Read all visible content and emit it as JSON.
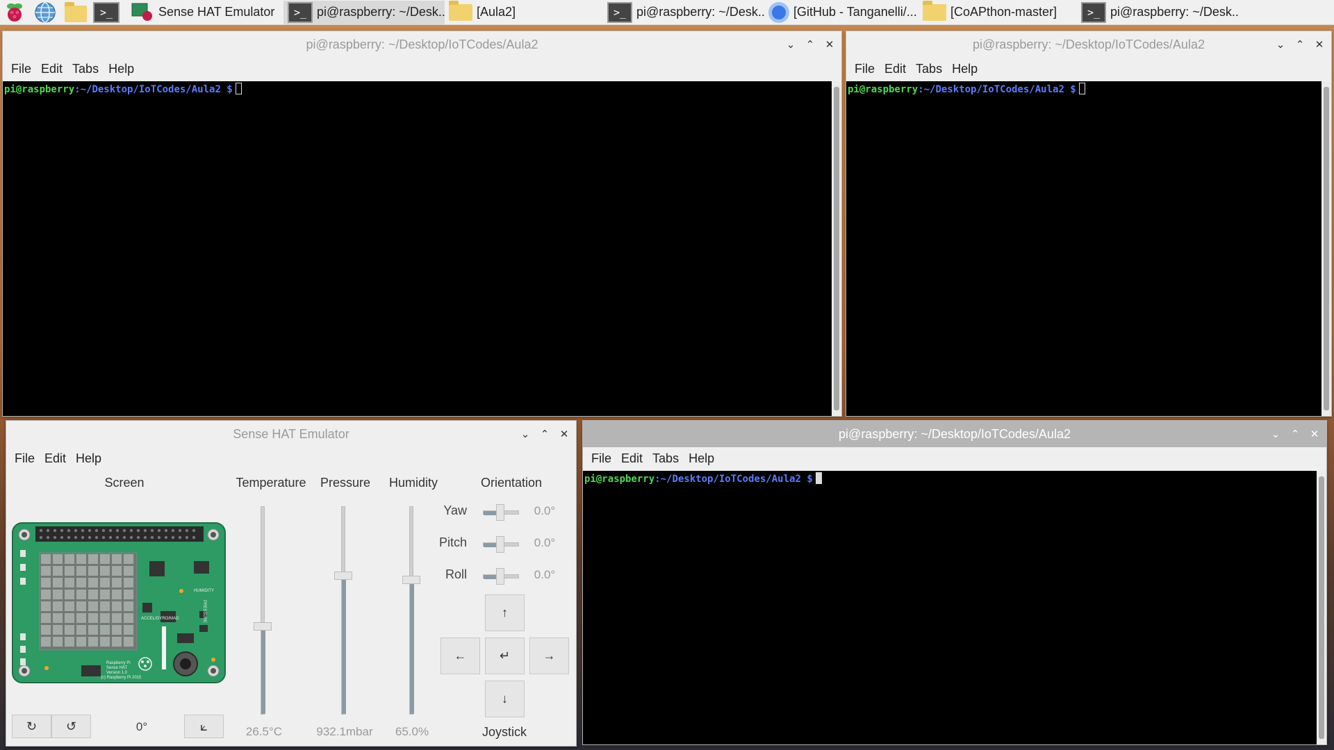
{
  "taskbar": {
    "tasks": [
      {
        "label": "Sense HAT Emulator",
        "icon": "sense-hat-icon"
      },
      {
        "label": "pi@raspberry: ~/Desk...",
        "icon": "terminal-icon"
      },
      {
        "label": "[Aula2]",
        "icon": "folder-icon"
      },
      {
        "label": "pi@raspberry: ~/Desk...",
        "icon": "terminal-icon"
      },
      {
        "label": "[GitHub - Tanganelli/...",
        "icon": "chromium-icon"
      },
      {
        "label": "[CoAPthon-master]",
        "icon": "folder-icon"
      },
      {
        "label": "pi@raspberry: ~/Desk...",
        "icon": "terminal-icon"
      }
    ],
    "terminal_glyph": ">_"
  },
  "terminals": {
    "title": "pi@raspberry: ~/Desktop/IoTCodes/Aula2",
    "menu": {
      "file": "File",
      "edit": "Edit",
      "tabs": "Tabs",
      "help": "Help"
    },
    "prompt": {
      "user": "pi@raspberry",
      "path": ":~/Desktop/IoTCodes/Aula2",
      "dollar": " $"
    }
  },
  "window_controls": {
    "minimize": "⌄",
    "maximize": "⌃",
    "close": "✕"
  },
  "sense_hat": {
    "title": "Sense HAT Emulator",
    "menu": {
      "file": "File",
      "edit": "Edit",
      "help": "Help"
    },
    "headers": {
      "screen": "Screen",
      "temperature": "Temperature",
      "pressure": "Pressure",
      "humidity": "Humidity",
      "orientation": "Orientation"
    },
    "values": {
      "temperature": "26.5°C",
      "pressure": "932.1mbar",
      "humidity": "65.0%"
    },
    "orientation": [
      {
        "label": "Yaw",
        "value": "0.0°"
      },
      {
        "label": "Pitch",
        "value": "0.0°"
      },
      {
        "label": "Roll",
        "value": "0.0°"
      }
    ],
    "joystick": {
      "label": "Joystick",
      "up": "↑",
      "down": "↓",
      "left": "←",
      "right": "→",
      "enter": "↵"
    },
    "rotation": {
      "cw": "↻",
      "ccw": "↺",
      "angle": "0°",
      "flip": "⟀"
    },
    "board_text": {
      "line1": "Raspberry Pi",
      "line2": "Sense HAT",
      "line3": "Version 1.0",
      "line4": "(c) Raspberry Pi 2015",
      "humidity_label": "HUMIDITY",
      "pressure_label": "PRESSURE",
      "accel_label": "ACCEL/GYRO/MAG"
    }
  }
}
